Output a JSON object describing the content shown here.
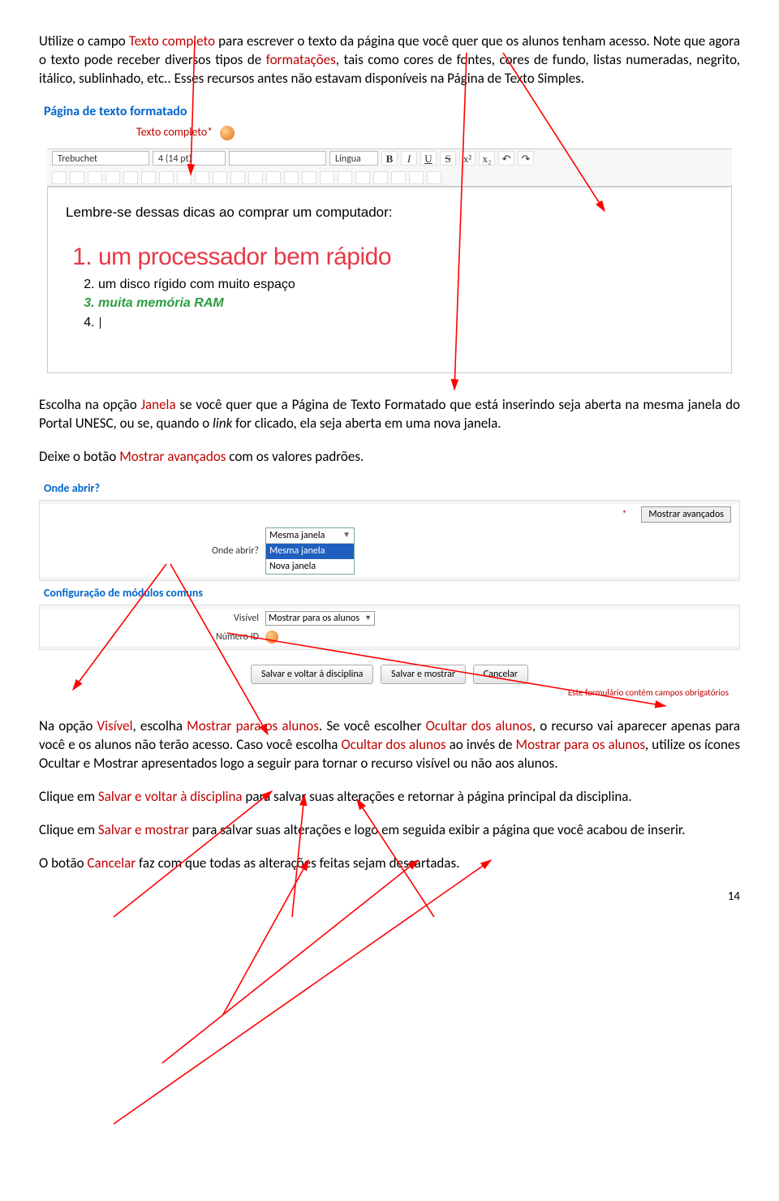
{
  "para1": {
    "t1": "Utilize o campo ",
    "r1": "Texto completo",
    "t2": " para escrever o texto da página que você quer que os alunos tenham acesso. Note que agora o texto pode receber diversos tipos de ",
    "r2": "formatações",
    "t3": ", tais como cores de fontes, cores de fundo, listas numeradas, negrito, itálico, sublinhado, etc.. Esses recursos antes não estavam disponíveis na Página de Texto Simples."
  },
  "editor": {
    "section_title": "Página de texto formatado",
    "field_label": "Texto completo*",
    "font": "Trebuchet",
    "size": "4 (14 pt)",
    "lang": "Língua",
    "btn": {
      "b": "B",
      "i": "I",
      "u": "U",
      "s": "S",
      "x2": "x²",
      "sub": "x₂"
    },
    "content_prompt": "Lembre-se dessas dicas ao comprar um computador:",
    "items": {
      "1": "um processador bem rápido",
      "2": "um disco rígido com muito espaço",
      "3": "muita memória RAM",
      "4": ""
    }
  },
  "para2": {
    "t1": "Escolha na opção ",
    "r1": "Janela",
    "t2": " se você quer que a Página de Texto Formatado que está inserindo seja aberta na mesma janela do Portal UNESC, ou se, quando o ",
    "it": "link",
    "t3": " for clicado, ela seja aberta em uma nova janela."
  },
  "para3": {
    "t1": "Deixe o botão ",
    "r1": "Mostrar avançados",
    "t2": " com os valores padrões."
  },
  "panel": {
    "head1": "Onde abrir?",
    "lbl_onde": "Onde abrir?",
    "dd_sel": "Mesma janela",
    "dd_opt1": "Mesma janela",
    "dd_opt2": "Nova janela",
    "btn_adv": "Mostrar avançados",
    "star": "*",
    "head2": "Configuração de módulos comuns",
    "lbl_vis": "Visível",
    "vis_val": "Mostrar para os alunos",
    "lbl_id": "Número ID",
    "btn_save_back": "Salvar e voltar à disciplina",
    "btn_save_show": "Salvar e mostrar",
    "btn_cancel": "Cancelar",
    "note": "Este formulário contém campos obrigatórios"
  },
  "para4": {
    "t1": "Na opção ",
    "r1": "Visível",
    "t2": ", escolha ",
    "r2": "Mostrar para os alunos",
    "t3": ". Se você escolher ",
    "r3": "Ocultar dos alunos",
    "t4": ", o recurso vai aparecer apenas para você e os alunos não terão acesso. Caso você escolha ",
    "r4": "Ocultar dos alunos",
    "t5": " ao invés de ",
    "r5": "Mostrar para os alunos",
    "t6": ", utilize os ícones Ocultar e Mostrar apresentados logo a seguir para tornar o recurso visível ou não aos alunos."
  },
  "para5": {
    "t1": "Clique em ",
    "r1": "Salvar e voltar à disciplina",
    "t2": " para salvar suas alterações e retornar à página principal da disciplina."
  },
  "para6": {
    "t1": "Clique em ",
    "r1": "Salvar e mostrar",
    "t2": " para salvar suas alterações e logo em seguida exibir a página que você acabou de inserir."
  },
  "para7": {
    "t1": "O botão ",
    "r1": "Cancelar",
    "t2": " faz com que todas as alterações feitas sejam descartadas."
  },
  "pagenum": "14"
}
